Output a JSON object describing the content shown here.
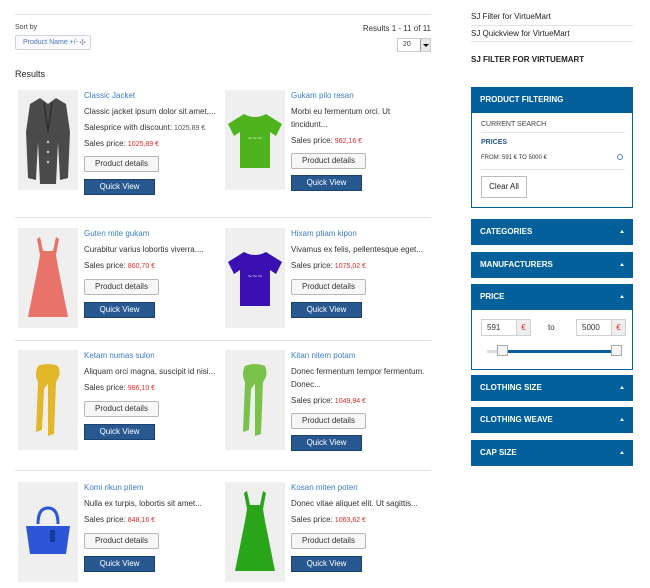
{
  "toolbar": {
    "sort_label": "Sort by",
    "sort_value": "Product Name +/-",
    "results_count": "Results 1 - 11 of 11",
    "limit_value": "20"
  },
  "results_heading": "Results",
  "products": [
    {
      "name": "Classic Jacket",
      "desc": "Classic jacket ipsum dolor sit amet,...",
      "discount_label": "Salesprice with discount:",
      "discount_value": "1025,89 €",
      "price_label": "Sales price:",
      "price": "1025,89 €",
      "details_label": "Product details",
      "quickview_label": "Quick View",
      "image": "jacket-icon",
      "color": "#4a4a4a"
    },
    {
      "name": "Gukam pilo resan",
      "desc": "Morbi eu fermentum orci. Ut",
      "desc2": "tincidunt...",
      "price_label": "Sales price:",
      "price": "962,16 €",
      "details_label": "Product details",
      "quickview_label": "Quick View",
      "image": "tshirt-icon",
      "color": "#4fb31f"
    },
    {
      "name": "Guten mite gukam",
      "desc": "Curabitur varius lobortis viverra....",
      "price_label": "Sales price:",
      "price": "860,70 €",
      "details_label": "Product details",
      "quickview_label": "Quick View",
      "image": "dress-icon",
      "color": "#e8736a"
    },
    {
      "name": "Hixam ptiam kipon",
      "desc": "Vivamus ex felis, pellentesque eget...",
      "price_label": "Sales price:",
      "price": "1075,02 €",
      "details_label": "Product details",
      "quickview_label": "Quick View",
      "image": "tshirt-icon",
      "color": "#3a10b0"
    },
    {
      "name": "Ketam numas sulon",
      "desc": "Aliquam orci magna, suscipit id nisi...",
      "price_label": "Sales price:",
      "price": "986,10 €",
      "details_label": "Product details",
      "quickview_label": "Quick View",
      "image": "scarf-icon",
      "color": "#e3b72a"
    },
    {
      "name": "Kitan nitem potam",
      "desc": "Donec fermentum tempor fermentum.",
      "desc2": "Donec...",
      "price_label": "Sales price:",
      "price": "1049,94 €",
      "details_label": "Product details",
      "quickview_label": "Quick View",
      "image": "scarf-icon",
      "color": "#7ac24a"
    },
    {
      "name": "Komi rikun pitem",
      "desc": "Nulla ex turpis, lobortis sit amet...",
      "price_label": "Sales price:",
      "price": "848,16 €",
      "details_label": "Product details",
      "quickview_label": "Quick View",
      "image": "handbag-icon",
      "color": "#2c55d8"
    },
    {
      "name": "Kosan miten poten",
      "desc": "Donec vitae aliquet elit. Ut sagittis...",
      "price_label": "Sales price:",
      "price": "1063,62 €",
      "details_label": "Product details",
      "quickview_label": "Quick View",
      "image": "dress-icon",
      "color": "#2aa51a"
    }
  ],
  "sidebar": {
    "link1": "SJ Filter for VirtueMart",
    "link2": "SJ Quickview for VirtueMart",
    "module_title": "SJ FILTER FOR VIRTUEMART",
    "product_filtering": "PRODUCT FILTERING",
    "current_search": "CURRENT SEARCH",
    "prices_label": "PRICES",
    "prices_range": "FROM: 591 € TO 5000 €",
    "clear_all": "Clear All",
    "categories": "CATEGORIES",
    "manufacturers": "MANUFACTURERS",
    "price": "PRICE",
    "price_min": "591",
    "price_max": "5000",
    "currency": "€",
    "to_label": "to",
    "clothing_size": "CLOTHING SIZE",
    "clothing_weave": "CLOTHING WEAVE",
    "cap_size": "CAP SIZE"
  },
  "colors": {
    "accent": "#04609b",
    "quickview": "#275890",
    "link": "#3b7ec4",
    "price": "#e12a2a"
  }
}
